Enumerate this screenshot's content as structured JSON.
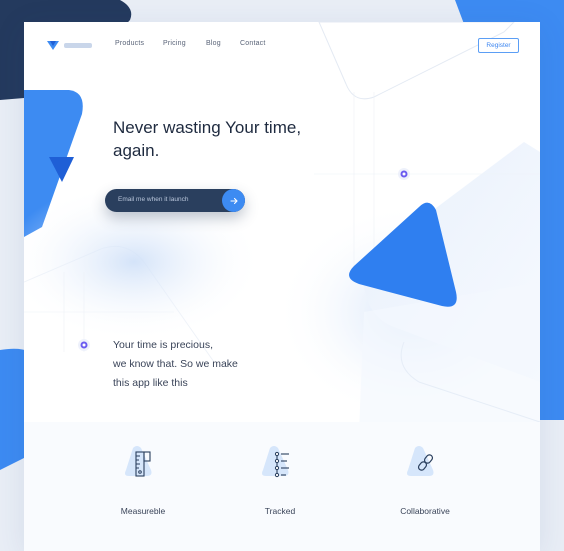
{
  "nav": {
    "brand_logo": "logo-icon",
    "links": [
      "Products",
      "Pricing",
      "Blog",
      "Contact"
    ],
    "register_label": "Register"
  },
  "hero": {
    "title_line1": "Never wasting Your time,",
    "title_line2": "again.",
    "email_placeholder": "Email me when it launch",
    "submit_icon": "arrow-right-icon"
  },
  "tagline": {
    "line1": "Your time is precious,",
    "line2": "we know that. So we make",
    "line3": "this app like this"
  },
  "features": [
    {
      "label": "Measureble",
      "icon": "ruler-icon"
    },
    {
      "label": "Tracked",
      "icon": "checklist-icon"
    },
    {
      "label": "Collaborative",
      "icon": "link-icon"
    }
  ],
  "colors": {
    "accent": "#3d8bf2",
    "dark": "#243a5e",
    "background": "#e9eef6"
  }
}
